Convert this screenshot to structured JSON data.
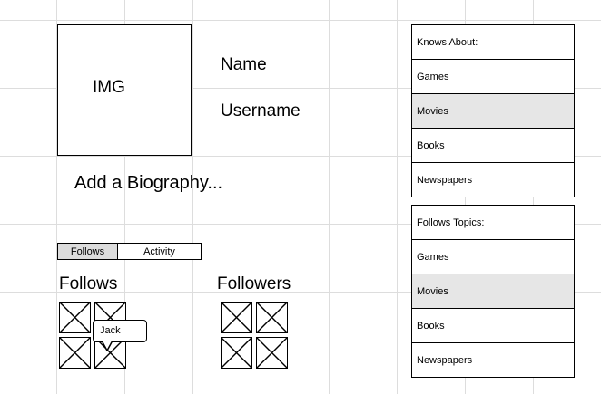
{
  "profile": {
    "image_placeholder": "IMG",
    "name_label": "Name",
    "username_label": "Username",
    "bio_placeholder": "Add a Biography..."
  },
  "tabs": [
    {
      "label": "Follows",
      "selected": true
    },
    {
      "label": "Activity",
      "selected": false
    }
  ],
  "follows": {
    "title": "Follows",
    "tooltip": "Jack"
  },
  "followers": {
    "title": "Followers"
  },
  "knows_about": {
    "header": "Knows About:",
    "items": [
      "Games",
      "Movies",
      "Books",
      "Newspapers"
    ],
    "selected": "Movies"
  },
  "follows_topics": {
    "header": "Follows Topics:",
    "items": [
      "Games",
      "Movies",
      "Books",
      "Newspapers"
    ],
    "selected": "Movies"
  },
  "colors": {
    "selected_row": "#e6e6e6",
    "selected_tab": "#dcdcdc",
    "grid": "#dddddd"
  }
}
